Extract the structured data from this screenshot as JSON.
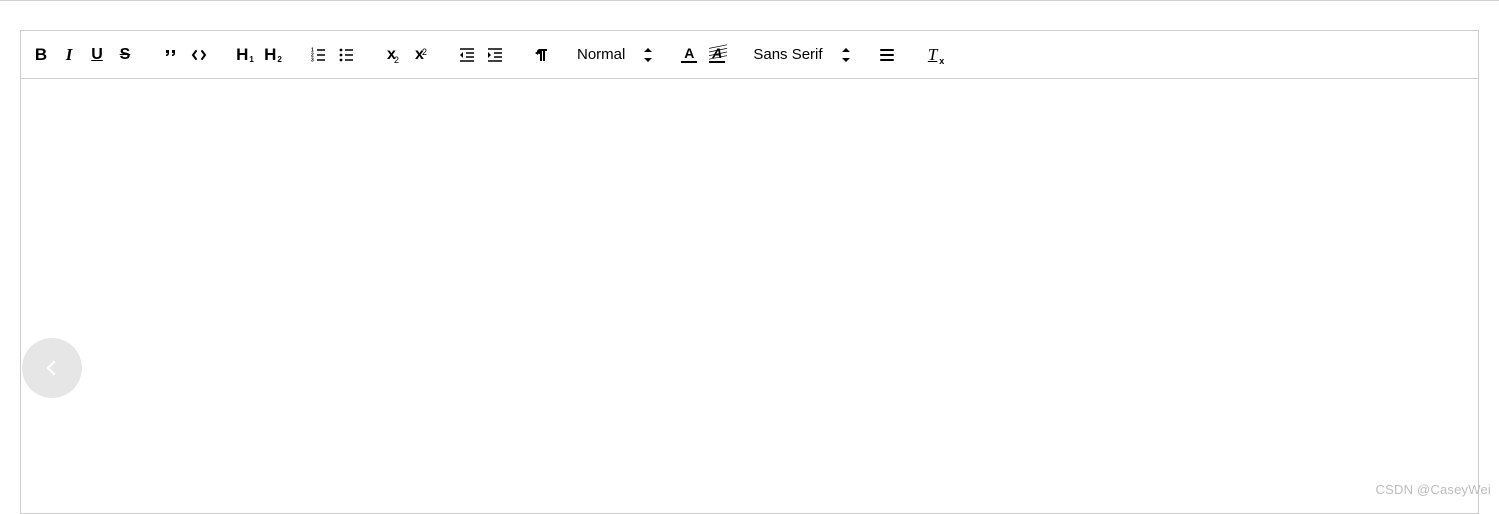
{
  "toolbar": {
    "size_label": "Normal",
    "font_label": "Sans Serif"
  },
  "watermark": "CSDN @CaseyWei"
}
